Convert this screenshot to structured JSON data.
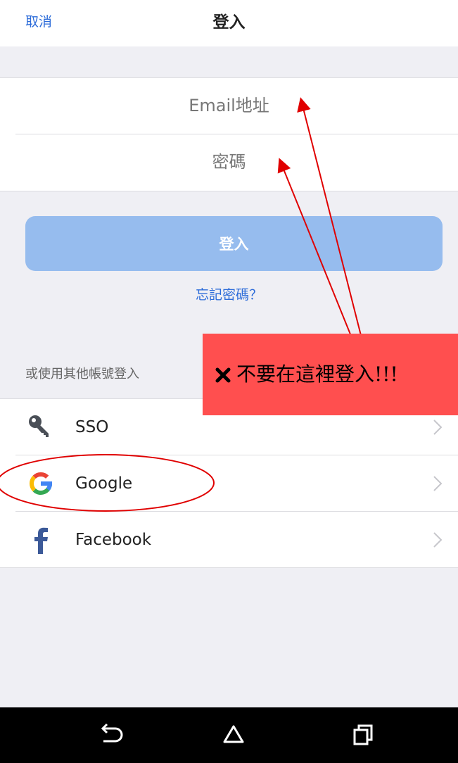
{
  "header": {
    "cancel_label": "取消",
    "title": "登入"
  },
  "form": {
    "email_placeholder": "Email地址",
    "password_placeholder": "密碼",
    "login_button": "登入",
    "forgot_password": "忘記密碼？"
  },
  "alt_login": {
    "section_label": "或使用其他帳號登入",
    "items": [
      {
        "label": "SSO",
        "icon": "key-icon"
      },
      {
        "label": "Google",
        "icon": "google-icon"
      },
      {
        "label": "Facebook",
        "icon": "facebook-icon"
      }
    ]
  },
  "annotation": {
    "warning_text": "不要在這裡登入!!!",
    "warning_box_color": "#ff4f4f",
    "arrow_color": "#e00000",
    "circle_color": "#e00000"
  },
  "nav": {
    "back_icon": "back-icon",
    "home_icon": "home-icon",
    "recent_icon": "recent-apps-icon"
  },
  "colors": {
    "accent": "#2d6cd9",
    "button": "#96bcee",
    "background": "#efeff4"
  }
}
